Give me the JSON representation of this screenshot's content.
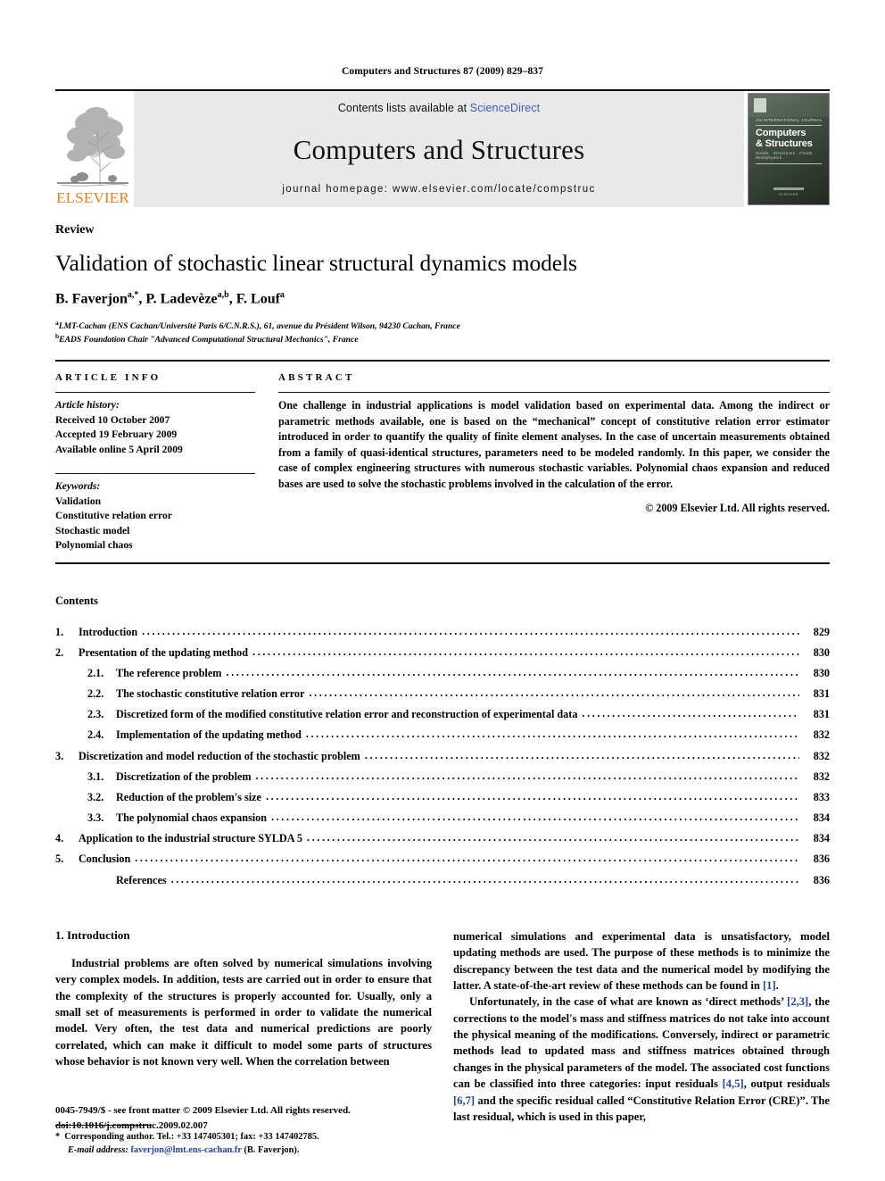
{
  "running_head": "Computers and Structures 87 (2009) 829–837",
  "masthead": {
    "publisher_name": "ELSEVIER",
    "contents_prefix": "Contents lists available at",
    "contents_link": "ScienceDirect",
    "journal_title": "Computers and Structures",
    "homepage_line": "journal homepage: www.elsevier.com/locate/compstruc",
    "link_color": "#3b5bbf",
    "publisher_color": "#f07c1a",
    "band_color": "#e9e9e9",
    "cover": {
      "kicker": "AN INTERNATIONAL JOURNAL",
      "title_line1": "Computers",
      "title_line2": "& Structures",
      "strapline": "Solids · Structures · Fluids · Multiphysics",
      "footer": "ELSEVIER"
    }
  },
  "article": {
    "type": "Review",
    "title": "Validation of stochastic linear structural dynamics models",
    "authors": [
      {
        "name": "B. Faverjon",
        "marks": "a,*"
      },
      {
        "name": "P. Ladevèze",
        "marks": "a,b"
      },
      {
        "name": "F. Louf",
        "marks": "a"
      }
    ],
    "affiliations": [
      {
        "mark": "a",
        "text": "LMT-Cachan (ENS Cachan/Université Paris 6/C.N.R.S.), 61, avenue du Président Wilson, 94230 Cachan, France"
      },
      {
        "mark": "b",
        "text": "EADS Foundation Chair \"Advanced Computational Structural Mechanics\", France"
      }
    ]
  },
  "article_info": {
    "heading": "ARTICLE INFO",
    "history_label": "Article history:",
    "history": [
      "Received 10 October 2007",
      "Accepted 19 February 2009",
      "Available online 5 April 2009"
    ],
    "keywords_label": "Keywords:",
    "keywords": [
      "Validation",
      "Constitutive relation error",
      "Stochastic model",
      "Polynomial chaos"
    ]
  },
  "abstract": {
    "heading": "ABSTRACT",
    "text": "One challenge in industrial applications is model validation based on experimental data. Among the indirect or parametric methods available, one is based on the “mechanical” concept of constitutive relation error estimator introduced in order to quantify the quality of finite element analyses. In the case of uncertain measurements obtained from a family of quasi-identical structures, parameters need to be modeled randomly. In this paper, we consider the case of complex engineering structures with numerous stochastic variables. Polynomial chaos expansion and reduced bases are used to solve the stochastic problems involved in the calculation of the error.",
    "copyright": "© 2009 Elsevier Ltd. All rights reserved."
  },
  "contents": {
    "heading": "Contents",
    "entries": [
      {
        "level": 1,
        "number": "1.",
        "label": "Introduction",
        "page": "829"
      },
      {
        "level": 1,
        "number": "2.",
        "label": "Presentation of the updating method",
        "page": "830"
      },
      {
        "level": 2,
        "number": "2.1.",
        "label": "The reference problem",
        "page": "830"
      },
      {
        "level": 2,
        "number": "2.2.",
        "label": "The stochastic constitutive relation error",
        "page": "831"
      },
      {
        "level": 2,
        "number": "2.3.",
        "label": "Discretized form of the modified constitutive relation error and reconstruction of experimental data",
        "page": "831"
      },
      {
        "level": 2,
        "number": "2.4.",
        "label": "Implementation of the updating method",
        "page": "832"
      },
      {
        "level": 1,
        "number": "3.",
        "label": "Discretization and model reduction of the stochastic problem",
        "page": "832"
      },
      {
        "level": 2,
        "number": "3.1.",
        "label": "Discretization of the problem",
        "page": "832"
      },
      {
        "level": 2,
        "number": "3.2.",
        "label": "Reduction of the problem's size",
        "page": "833"
      },
      {
        "level": 2,
        "number": "3.3.",
        "label": "The polynomial chaos expansion",
        "page": "834"
      },
      {
        "level": 1,
        "number": "4.",
        "label": "Application to the industrial structure SYLDA 5",
        "page": "834"
      },
      {
        "level": 1,
        "number": "5.",
        "label": "Conclusion",
        "page": "836"
      },
      {
        "level": 2,
        "number": "",
        "label": "References",
        "page": "836"
      }
    ]
  },
  "introduction": {
    "heading": "1. Introduction",
    "left_para_1": "Industrial problems are often solved by numerical simulations involving very complex models. In addition, tests are carried out in order to ensure that the complexity of the structures is properly accounted for. Usually, only a small set of measurements is performed in order to validate the numerical model. Very often, the test data and numerical predictions are poorly correlated, which can make it difficult to model some parts of structures whose behavior is not known very well. When the correlation between",
    "right_para_1": "numerical simulations and experimental data is unsatisfactory, model updating methods are used. The purpose of these methods is to minimize the discrepancy between the test data and the numerical model by modifying the latter. A state-of-the-art review of these methods can be found in [1].",
    "right_para_2": "Unfortunately, in the case of what are known as ‘direct methods’ [2,3], the corrections to the model's mass and stiffness matrices do not take into account the physical meaning of the modifications. Conversely, indirect or parametric methods lead to updated mass and stiffness matrices obtained through changes in the physical parameters of the model. The associated cost functions can be classified into three categories: input residuals [4,5], output residuals [6,7] and the specific residual called “Constitutive Relation Error (CRE)”. The last residual, which is used in this paper,"
  },
  "footnote": {
    "star": "*",
    "corresponding": "Corresponding author. Tel.: +33 147405301; fax: +33 147402785.",
    "email_label": "E-mail address:",
    "email": "faverjon@lmt.ens-cachan.fr",
    "email_owner": "(B. Faverjon).",
    "link_color": "#243f9e"
  },
  "page_footer": {
    "line1": "0045-7949/$ - see front matter © 2009 Elsevier Ltd. All rights reserved.",
    "line2": "doi:10.1016/j.compstruc.2009.02.007"
  }
}
